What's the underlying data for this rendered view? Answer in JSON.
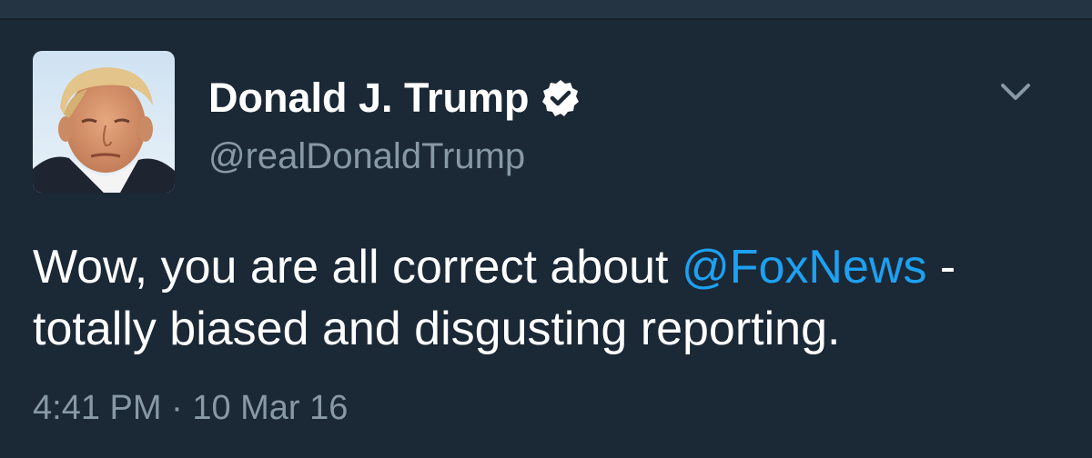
{
  "tweet": {
    "author": {
      "display_name": "Donald J. Trump",
      "handle": "@realDonaldTrump",
      "verified": true,
      "avatar_icon": "profile-photo"
    },
    "text": {
      "part1": "Wow, you are all correct about ",
      "mention": "@FoxNews",
      "part2": " - totally biased and disgusting reporting."
    },
    "time": "4:41 PM",
    "separator": "·",
    "date": "10 Mar 16",
    "menu_icon": "chevron-down-icon"
  },
  "colors": {
    "background": "#1b2836",
    "text": "#ffffff",
    "secondary_text": "#8899a6",
    "link": "#1da1f2"
  }
}
